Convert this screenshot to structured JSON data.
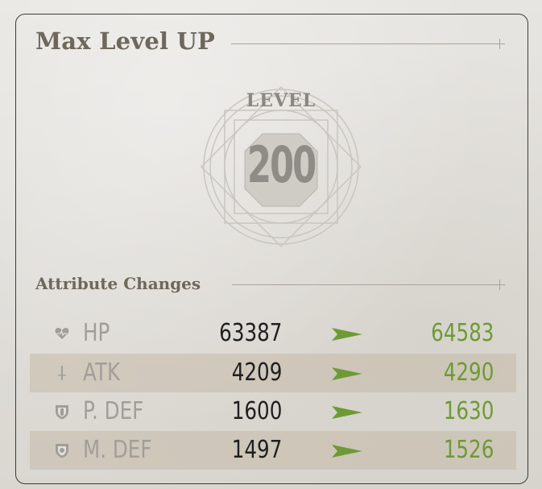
{
  "header": {
    "title": "Max Level UP"
  },
  "level": {
    "label": "LEVEL",
    "value": "200"
  },
  "attributes": {
    "title": "Attribute Changes",
    "rows": [
      {
        "icon": "heart-icon",
        "name": "HP",
        "old": "63387",
        "new": "64583"
      },
      {
        "icon": "sword-icon",
        "name": "ATK",
        "old": "4209",
        "new": "4290"
      },
      {
        "icon": "shield-icon",
        "name": "P. DEF",
        "old": "1600",
        "new": "1630"
      },
      {
        "icon": "magic-shield-icon",
        "name": "M. DEF",
        "old": "1497",
        "new": "1526"
      }
    ]
  },
  "colors": {
    "title_text": "#6e675c",
    "increase_value": "#6e9a35",
    "arrow": "#6e9a35",
    "old_value": "#1f1f1f",
    "stat_name": "#a19e99",
    "row_shade": "#c4baa8"
  }
}
